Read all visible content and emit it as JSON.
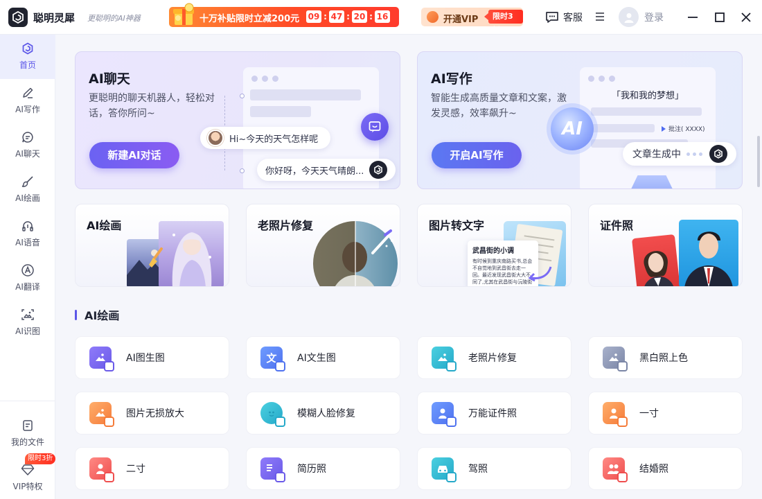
{
  "app": {
    "name": "聪明灵犀",
    "slogan": "更聪明的AI神器"
  },
  "promo": {
    "text": "十万补贴限时立减200元",
    "timer": [
      "09",
      "47",
      "20",
      "16"
    ]
  },
  "header": {
    "vip_label": "开通VIP",
    "vip_badge": "限时3折",
    "service_label": "客服",
    "login_label": "登录"
  },
  "sidebar": {
    "items": [
      {
        "label": "首页",
        "icon": "home-icon"
      },
      {
        "label": "AI写作",
        "icon": "pen-icon"
      },
      {
        "label": "AI聊天",
        "icon": "chat-icon"
      },
      {
        "label": "AI绘画",
        "icon": "brush-icon"
      },
      {
        "label": "AI语音",
        "icon": "headphones-icon"
      },
      {
        "label": "AI翻译",
        "icon": "translate-icon"
      },
      {
        "label": "AI识图",
        "icon": "image-scan-icon"
      }
    ],
    "bottom": {
      "files_label": "我的文件",
      "vip_label": "VIP特权",
      "vip_badge": "限时3折"
    }
  },
  "hero_chat": {
    "title": "AI聊天",
    "desc": "更聪明的聊天机器人，轻松对话，答你所问~",
    "button": "新建AI对话",
    "user_msg": "Hi~今天的天气怎样呢",
    "bot_msg": "你好呀，今天天气晴朗..."
  },
  "hero_write": {
    "title": "AI写作",
    "desc": "智能生成高质量文章和文案，激发灵感，效率飙升~",
    "button": "开启AI写作",
    "doc_title": "「我和我的梦想」",
    "orb_text": "AI",
    "annotation": "批注( XXXX)",
    "generating": "文章生成中"
  },
  "features": [
    {
      "title": "AI绘画"
    },
    {
      "title": "老照片修复"
    },
    {
      "title": "图片转文字",
      "doc_title": "武昌街的小调",
      "doc_text": "有时候到重庆南路买书,总会不自觉地到武昌街去走一回。最近发现武昌街大大不同了,尤其在武昌街与沅陵街交叉...横,沿有告回招东..."
    },
    {
      "title": "证件照"
    }
  ],
  "section": {
    "title": "AI绘画"
  },
  "tools": [
    {
      "label": "AI图生图",
      "icon": "image-to-image-icon",
      "color": "purple"
    },
    {
      "label": "AI文生图",
      "icon": "text-to-image-icon",
      "color": "blue"
    },
    {
      "label": "老照片修复",
      "icon": "photo-restore-icon",
      "color": "teal"
    },
    {
      "label": "黑白照上色",
      "icon": "colorize-icon",
      "color": "slate"
    },
    {
      "label": "图片无损放大",
      "icon": "upscale-icon",
      "color": "orange"
    },
    {
      "label": "模糊人脸修复",
      "icon": "face-repair-icon",
      "color": "teal"
    },
    {
      "label": "万能证件照",
      "icon": "id-photo-icon",
      "color": "blue"
    },
    {
      "label": "一寸",
      "icon": "one-inch-photo-icon",
      "color": "orange"
    },
    {
      "label": "二寸",
      "icon": "two-inch-photo-icon",
      "color": "red"
    },
    {
      "label": "简历照",
      "icon": "resume-photo-icon",
      "color": "purple"
    },
    {
      "label": "驾照",
      "icon": "driver-license-icon",
      "color": "teal"
    },
    {
      "label": "结婚照",
      "icon": "wedding-photo-icon",
      "color": "red"
    }
  ]
}
